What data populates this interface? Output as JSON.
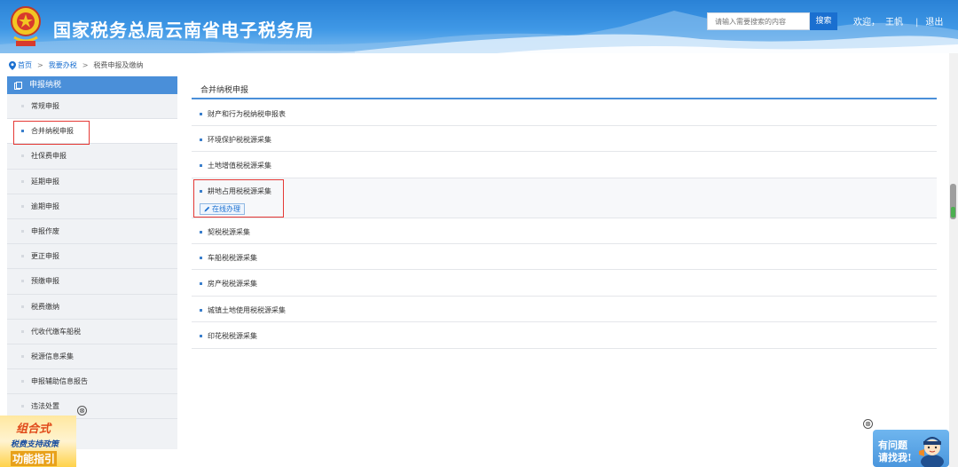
{
  "header": {
    "title": "国家税务总局云南省电子税务局",
    "search_placeholder": "请输入需要搜索的内容",
    "search_button": "搜索",
    "welcome": "欢迎，",
    "username": "王帆",
    "separator": "|",
    "logout": "退出"
  },
  "breadcrumb": {
    "home": "首页",
    "level2": "我要办税",
    "current": "税费申报及缴纳",
    "separator": ">"
  },
  "sidebar": {
    "header": "申报纳税",
    "items": [
      {
        "label": "常规申报"
      },
      {
        "label": "合并纳税申报"
      },
      {
        "label": "社保费申报"
      },
      {
        "label": "延期申报"
      },
      {
        "label": "逾期申报"
      },
      {
        "label": "申报作废"
      },
      {
        "label": "更正申报"
      },
      {
        "label": "预缴申报"
      },
      {
        "label": "税费缴纳"
      },
      {
        "label": "代收代缴车船税"
      },
      {
        "label": "税源信息采集"
      },
      {
        "label": "申报辅助信息报告"
      },
      {
        "label": "违法处置"
      }
    ],
    "active_index": 1
  },
  "main": {
    "title": "合并纳税申报",
    "rows": [
      {
        "label": "财产和行为税纳税申报表"
      },
      {
        "label": "环境保护税税源采集"
      },
      {
        "label": "土地增值税税源采集"
      },
      {
        "label": "耕地占用税税源采集",
        "action": "在线办理"
      },
      {
        "label": "契税税源采集"
      },
      {
        "label": "车船税税源采集"
      },
      {
        "label": "房产税税源采集"
      },
      {
        "label": "城镇土地使用税税源采集"
      },
      {
        "label": "印花税税源采集"
      }
    ]
  },
  "widgets": {
    "policy": {
      "line1": "组合式",
      "line2": "税费支持政策",
      "line3": "功能指引"
    },
    "help": {
      "line1": "有问题",
      "line2": "请找我!"
    },
    "close_symbol": "⊗"
  },
  "colors": {
    "header_blue": "#2a82d6",
    "accent": "#4a8fd9",
    "link": "#1a6fd0",
    "highlight_border": "#e53935"
  }
}
